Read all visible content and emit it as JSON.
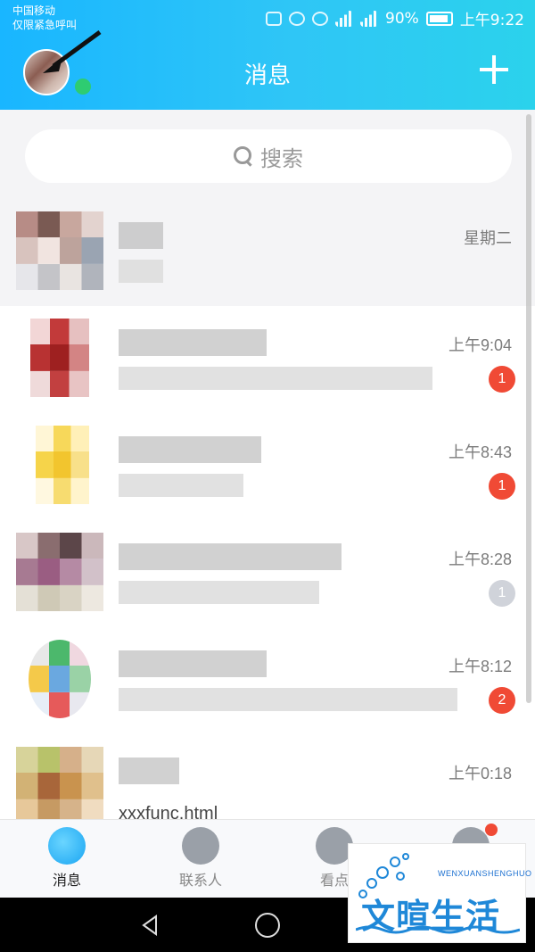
{
  "status_bar": {
    "carrier_line1": "中国移动",
    "carrier_line2": "仅限紧急呼叫",
    "battery": "90%",
    "time": "上午9:22"
  },
  "header": {
    "title": "消息"
  },
  "search": {
    "placeholder": "搜索"
  },
  "conversations": [
    {
      "time": "星期二",
      "badge": ""
    },
    {
      "time": "上午9:04",
      "badge": "1"
    },
    {
      "time": "上午8:43",
      "badge": "1"
    },
    {
      "time": "上午8:28",
      "badge": "1"
    },
    {
      "time": "上午8:12",
      "badge": "2"
    },
    {
      "time": "上午0:18",
      "badge": "",
      "visible_suffix": "xxxfunc.html"
    }
  ],
  "bottom_nav": {
    "tabs": [
      {
        "label": "消息"
      },
      {
        "label": "联系人"
      },
      {
        "label": "看点"
      },
      {
        "label": ""
      }
    ]
  },
  "watermark": {
    "brand": "文暄生活",
    "brand_small": "WENXUANSHENGHUO"
  },
  "colors": {
    "header_blue": "#19b6ff",
    "badge_red": "#f04a35",
    "badge_grey": "#d0d3da",
    "online_green": "#2ecc71"
  }
}
